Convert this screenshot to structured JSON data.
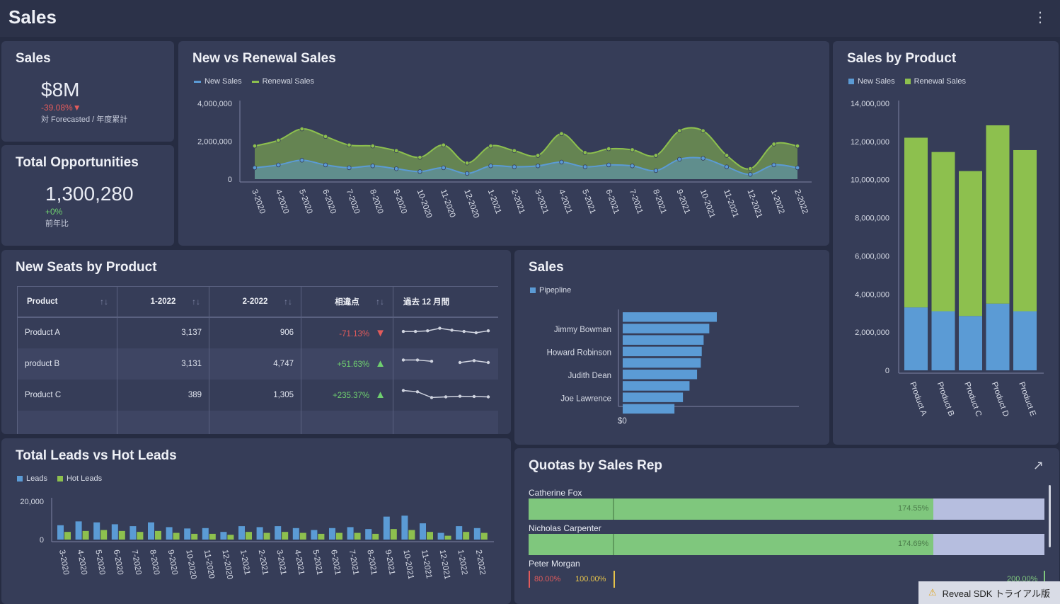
{
  "header": {
    "title": "Sales",
    "menu_icon": "kebab-menu-icon"
  },
  "kpi_sales": {
    "title": "Sales",
    "value": "$8M",
    "delta": "-39.08%▼",
    "note": "対 Forecasted / 年度累計"
  },
  "kpi_opps": {
    "title": "Total Opportunities",
    "value": "1,300,280",
    "delta": "+0%",
    "note": "前年比"
  },
  "new_vs_renewal": {
    "title": "New vs Renewal Sales",
    "legend": [
      "New Sales",
      "Renewal Sales"
    ],
    "colors": {
      "new": "#8dc04e",
      "renewal": "#5b9bd5"
    }
  },
  "sales_by_product": {
    "title": "Sales by Product",
    "legend": [
      "New Sales",
      "Renewal Sales"
    ]
  },
  "new_seats": {
    "title": "New Seats by Product",
    "columns": [
      "Product",
      "1-2022",
      "2-2022",
      "相違点",
      "過去 12 月間"
    ],
    "rows": [
      {
        "product": "Product A",
        "v1": "3,137",
        "v2": "906",
        "diff": "-71.13%",
        "dir": "down"
      },
      {
        "product": "product B",
        "v1": "3,131",
        "v2": "4,747",
        "diff": "+51.63%",
        "dir": "up"
      },
      {
        "product": "Product C",
        "v1": "389",
        "v2": "1,305",
        "diff": "+235.37%",
        "dir": "up"
      }
    ]
  },
  "sales_pipeline": {
    "title": "Sales",
    "legend": "Pipepline",
    "axis_zero": "$0"
  },
  "leads": {
    "title": "Total Leads vs Hot Leads",
    "legend": [
      "Leads",
      "Hot Leads"
    ]
  },
  "quotas": {
    "title": "Quotas by Sales Rep",
    "expand_icon": "expand-arrow-icon",
    "reps": [
      {
        "name": "Catherine Fox",
        "pct": "174.55%",
        "fill": 0.785
      },
      {
        "name": "Nicholas Carpenter",
        "pct": "174.69%",
        "fill": 0.785
      },
      {
        "name": "Peter Morgan",
        "low": "80.00%",
        "mid": "100.00%",
        "high": "200.00%"
      }
    ]
  },
  "trial_banner": {
    "text": "Reveal SDK トライアル版",
    "icon": "warning-icon"
  },
  "chart_data": [
    {
      "type": "area",
      "title": "New vs Renewal Sales",
      "categories": [
        "3-2020",
        "4-2020",
        "5-2020",
        "6-2020",
        "7-2020",
        "8-2020",
        "9-2020",
        "10-2020",
        "11-2020",
        "12-2020",
        "1-2021",
        "2-2021",
        "3-2021",
        "4-2021",
        "5-2021",
        "6-2021",
        "7-2021",
        "8-2021",
        "9-2021",
        "10-2021",
        "11-2021",
        "12-2021",
        "1-2022",
        "2-2022"
      ],
      "series": [
        {
          "name": "New Sales",
          "values": [
            1750000,
            2050000,
            2650000,
            2250000,
            1800000,
            1750000,
            1500000,
            1150000,
            1800000,
            850000,
            1750000,
            1500000,
            1250000,
            2400000,
            1400000,
            1600000,
            1550000,
            1250000,
            2550000,
            2550000,
            1250000,
            550000,
            1850000,
            1750000
          ]
        },
        {
          "name": "Renewal Sales",
          "values": [
            600000,
            750000,
            1000000,
            750000,
            600000,
            700000,
            550000,
            400000,
            600000,
            300000,
            700000,
            650000,
            700000,
            900000,
            650000,
            750000,
            700000,
            450000,
            1050000,
            1100000,
            650000,
            250000,
            750000,
            600000
          ]
        }
      ],
      "ylim": [
        0,
        4000000
      ],
      "yticks": [
        "4,000,000",
        "2,000,000",
        "0"
      ]
    },
    {
      "type": "bar",
      "title": "Sales by Product",
      "categories": [
        "Product A",
        "Product B",
        "Product C",
        "Product D",
        "Product E"
      ],
      "series": [
        {
          "name": "Renewal Sales",
          "values": [
            3300000,
            3100000,
            2850000,
            3500000,
            3100000
          ]
        },
        {
          "name": "New Sales",
          "values": [
            8900000,
            8350000,
            7600000,
            9350000,
            8450000
          ]
        }
      ],
      "ylim": [
        0,
        14000000
      ],
      "yticks": [
        "14,000,000",
        "12,000,000",
        "10,000,000",
        "8,000,000",
        "6,000,000",
        "4,000,000",
        "2,000,000",
        "0"
      ]
    },
    {
      "type": "bar",
      "title": "Sales",
      "orientation": "horizontal",
      "categories": [
        "Jimmy Bowman",
        "Howard Robinson",
        "Judith Dean",
        "Joe Lawrence"
      ],
      "series": [
        {
          "name": "Pipepline",
          "values": [
            100,
            92,
            86,
            84,
            83,
            79,
            71,
            64,
            55
          ]
        }
      ]
    },
    {
      "type": "bar",
      "title": "Total Leads vs Hot Leads",
      "categories": [
        "3-2020",
        "4-2020",
        "5-2020",
        "6-2020",
        "7-2020",
        "8-2020",
        "9-2020",
        "10-2020",
        "11-2020",
        "12-2020",
        "1-2021",
        "2-2021",
        "3-2021",
        "4-2021",
        "5-2021",
        "6-2021",
        "7-2021",
        "8-2021",
        "9-2021",
        "10-2021",
        "11-2021",
        "12-2021",
        "1-2022",
        "2-2022"
      ],
      "series": [
        {
          "name": "Leads",
          "values": [
            7500,
            9500,
            9000,
            8000,
            7000,
            9000,
            6500,
            5800,
            6000,
            4000,
            7000,
            6500,
            7000,
            6000,
            5000,
            6000,
            6500,
            5500,
            12000,
            12500,
            8500,
            3500,
            7000,
            6000
          ]
        },
        {
          "name": "Hot Leads",
          "values": [
            4000,
            4500,
            5000,
            4500,
            4000,
            4500,
            3500,
            3000,
            3000,
            2500,
            4000,
            3500,
            4000,
            3500,
            3000,
            3500,
            3500,
            3000,
            5500,
            5000,
            4000,
            2000,
            4000,
            3500
          ]
        }
      ],
      "ylim": [
        0,
        20000
      ],
      "yticks": [
        "20,000",
        "0"
      ]
    }
  ],
  "sparklines": [
    [
      0.45,
      0.45,
      0.4,
      0.2,
      0.35,
      0.45,
      0.55,
      0.4
    ],
    [
      0.3,
      0.3,
      0.4,
      null,
      0.5,
      0.35,
      0.5
    ],
    [
      0.25,
      0.35,
      0.8,
      0.75,
      0.7,
      0.72,
      0.75
    ]
  ]
}
